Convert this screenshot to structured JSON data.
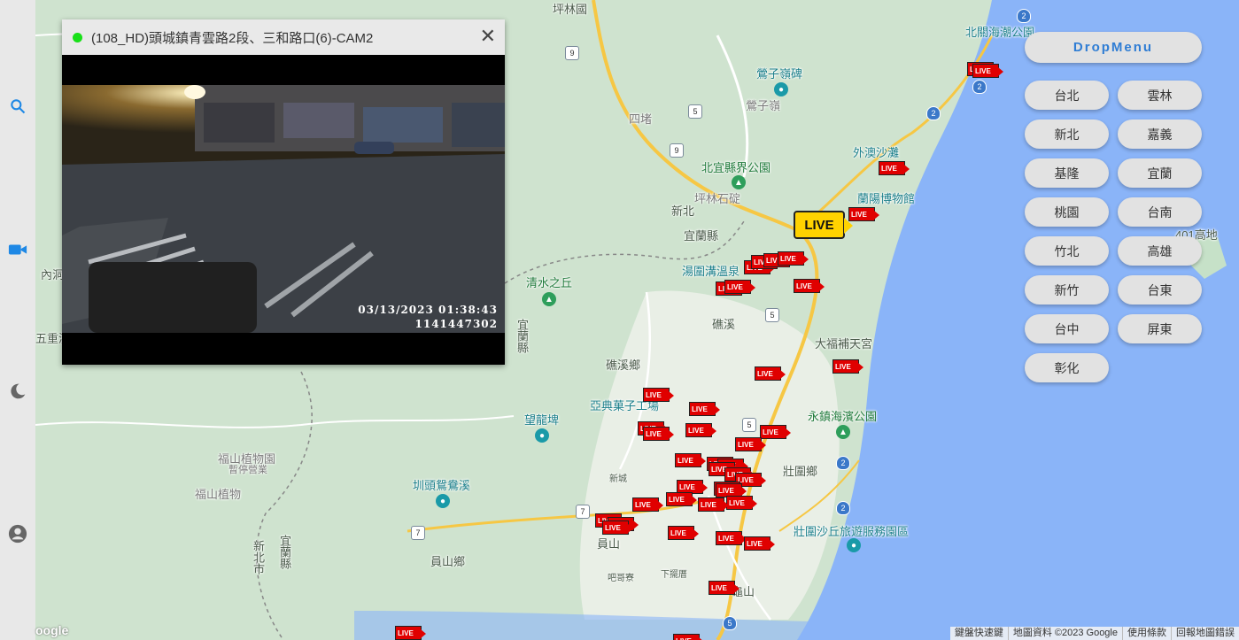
{
  "sidebar": {
    "icons": [
      "search-icon",
      "camera-icon",
      "moon-icon",
      "account-icon"
    ]
  },
  "camera": {
    "title": "(108_HD)頭城鎮青雲路2段、三和路口(6)-CAM2",
    "status_color": "#19e019",
    "datetime": "03/13/2023  01:38:43",
    "frame_id": "1141447302"
  },
  "menu": {
    "label": "DropMenu",
    "regions_left": [
      "台北",
      "新北",
      "基隆",
      "桃園",
      "竹北",
      "新竹",
      "台中",
      "彰化"
    ],
    "regions_right": [
      "雲林",
      "嘉義",
      "宜蘭",
      "台南",
      "高雄",
      "台東",
      "屏東"
    ]
  },
  "map": {
    "live_label": "LIVE",
    "places": {
      "yingzi": "鶯子嶺碑",
      "yingzi2": "鶯子嶺",
      "sidu": "四堵",
      "north_yilan": "北宜縣界公園",
      "penglin": "坪林石碇",
      "xinbei": "新北",
      "yilan_county": "宜蘭縣",
      "waiao": "外澳沙灘",
      "lanyang": "蘭陽博物館",
      "highland": "401高地",
      "beiguan": "北關海潮公園",
      "tangwei": "湯圍溝溫泉",
      "qingshui": "清水之丘",
      "jiaoxi": "礁溪",
      "jiaoxi_town": "礁溪鄉",
      "dafu": "大福補天宮",
      "yadian": "亞典菓子工場",
      "wanglong": "望龍埤",
      "yongzhen": "永鎮海濱公園",
      "zhuangwei": "壯圍鄉",
      "fushan": "福山植物園",
      "fushan_note": "暫停營業",
      "fushan2": "福山植物",
      "kantou": "圳頭鴛鴦溪",
      "xincheng": "新城",
      "yuanshan": "員山",
      "yuanshan_town": "員山鄉",
      "zhuangwei_sand": "壯圍沙丘旅遊服務園區",
      "yilan_county_v": "宜蘭縣",
      "xinbei_city_v": "新北市",
      "yilan_v": "宜蘭縣",
      "wuchong": "五重溪",
      "neidong": "內洞",
      "pinglin_top": "坪林國",
      "xiazhuangwei": "下擺厝",
      "bazhai": "吧哥寮",
      "zhushan": "龜山"
    }
  },
  "attribution": [
    "鍵盤快速鍵",
    "地圖資料 ©2023 Google",
    "使用條款",
    "回報地圖錯誤"
  ],
  "google_logo": "oogle"
}
